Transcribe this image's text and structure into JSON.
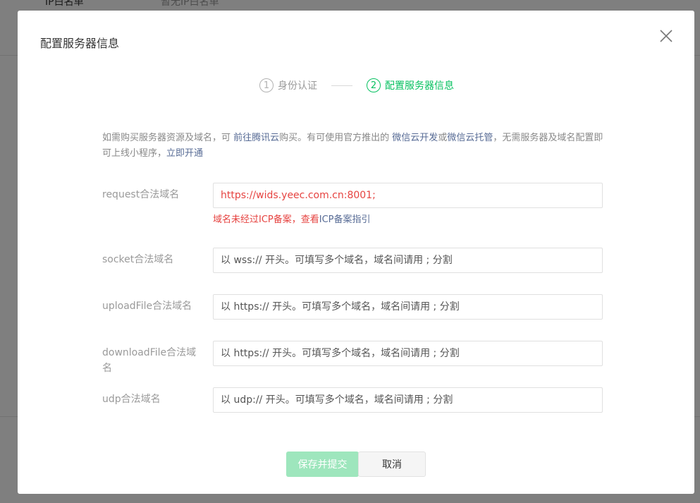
{
  "background": {
    "row1_left": "IP白名单",
    "row1_right": "暂无IP白名单"
  },
  "dialog": {
    "title": "配置服务器信息",
    "close_icon": "close-icon"
  },
  "steps": [
    {
      "num": "1",
      "label": "身份认证",
      "active": false
    },
    {
      "num": "2",
      "label": "配置服务器信息",
      "active": true
    }
  ],
  "description": {
    "part1": "如需购买服务器资源及域名，可 ",
    "link1": "前往腾讯云",
    "part2": "购买。有可使用官方推出的 ",
    "link2": "微信云开发",
    "part3": "或",
    "link3": "微信云托管",
    "part4": "，无需服务器及域名配置即可上线小程序，",
    "link4": "立即开通"
  },
  "form": {
    "request": {
      "label": "request合法域名",
      "value": "https://wids.yeec.com.cn:8001;",
      "error_text": "域名未经过ICP备案，查看",
      "error_link": "ICP备案指引"
    },
    "socket": {
      "label": "socket合法域名",
      "placeholder": "以 wss:// 开头。可填写多个域名，域名间请用 ; 分割"
    },
    "uploadFile": {
      "label": "uploadFile合法域名",
      "placeholder": "以 https:// 开头。可填写多个域名，域名间请用 ; 分割"
    },
    "downloadFile": {
      "label": "downloadFile合法域名",
      "placeholder": "以 https:// 开头。可填写多个域名，域名间请用 ; 分割"
    },
    "udp": {
      "label": "udp合法域名",
      "placeholder": "以 udp:// 开头。可填写多个域名，域名间请用 ; 分割"
    }
  },
  "buttons": {
    "submit": "保存并提交",
    "cancel": "取消"
  },
  "colors": {
    "accent": "#07c160",
    "link": "#576b95",
    "error": "#e64340",
    "disabled_primary": "#9ee6bd"
  }
}
